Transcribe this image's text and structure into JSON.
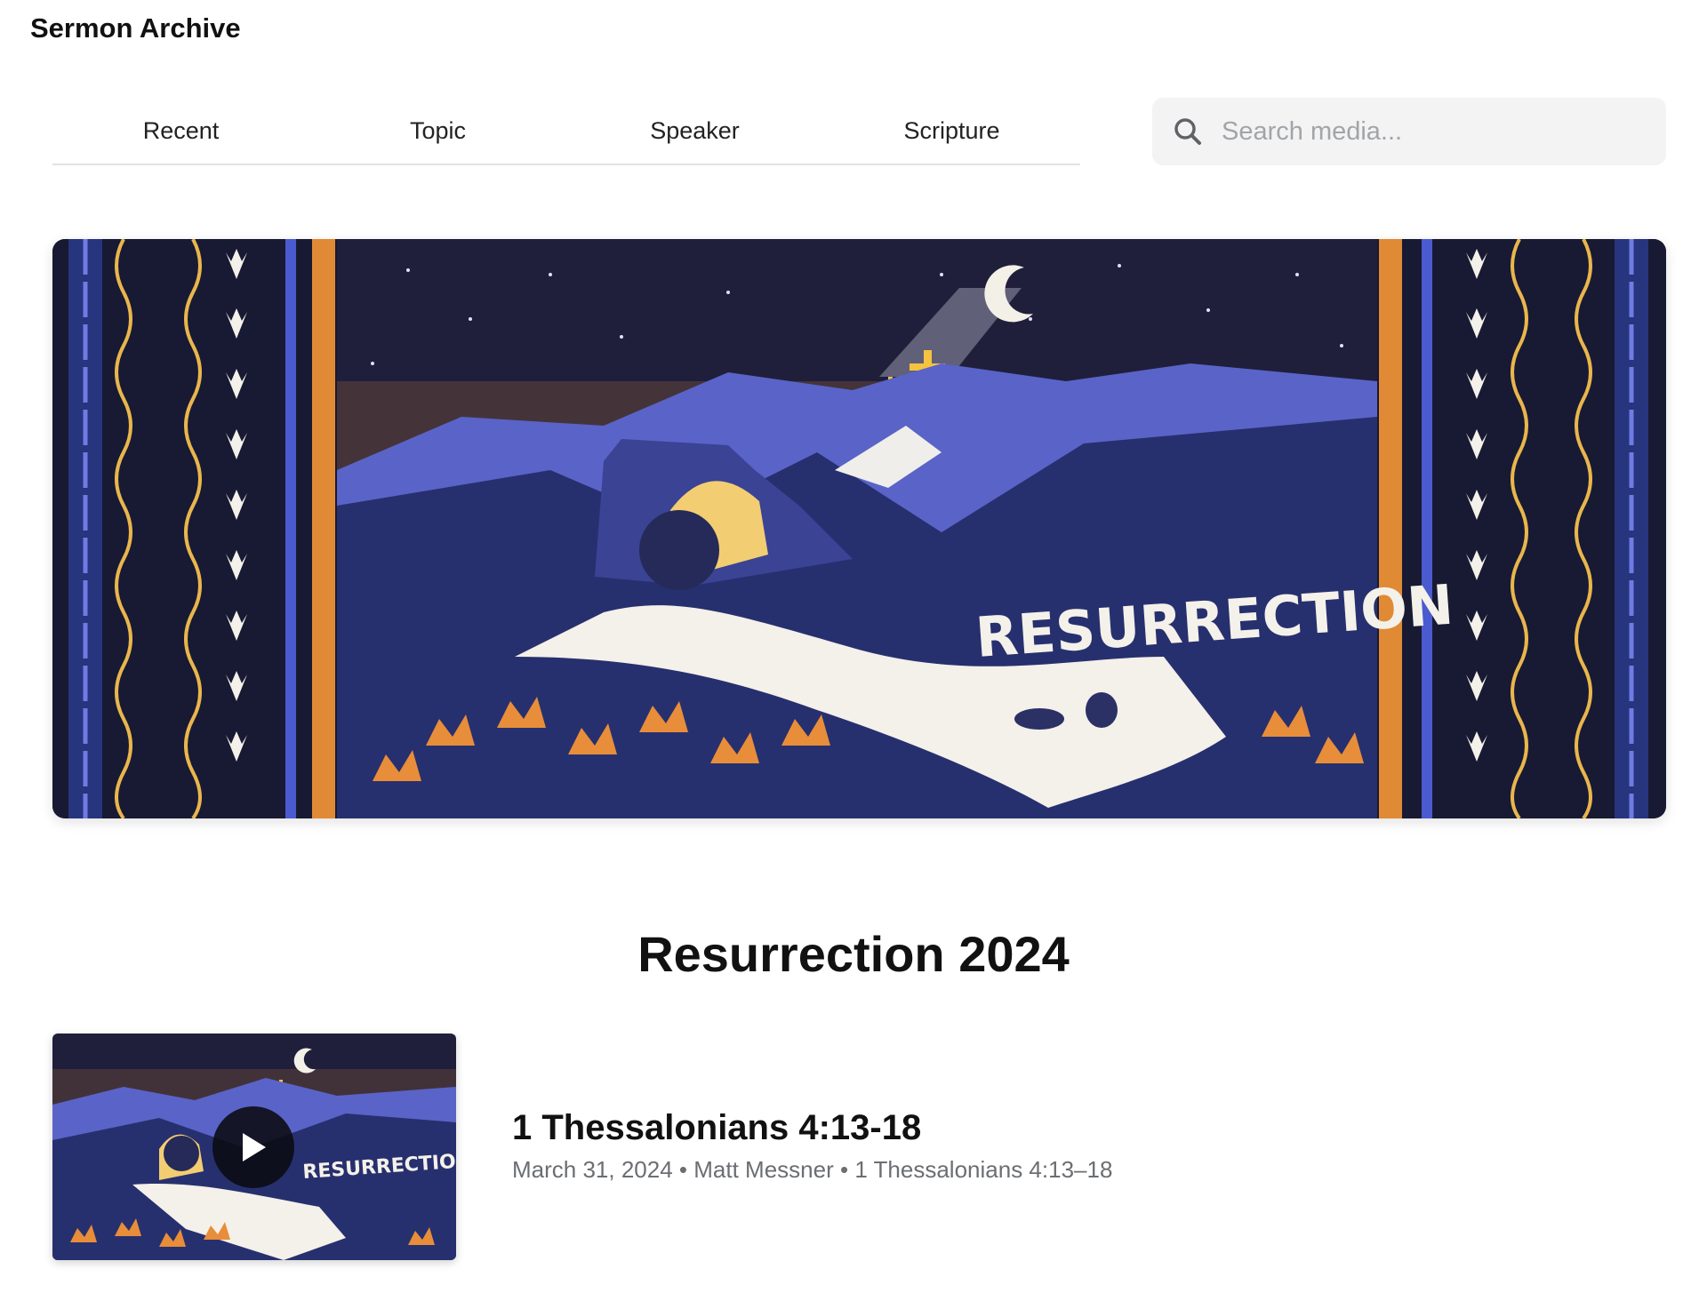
{
  "app": {
    "title": "Sermon Archive"
  },
  "nav": {
    "tabs": [
      {
        "label": "Recent"
      },
      {
        "label": "Topic"
      },
      {
        "label": "Speaker"
      },
      {
        "label": "Scripture"
      }
    ]
  },
  "search": {
    "placeholder": "Search media...",
    "value": "",
    "icon": "search-icon"
  },
  "hero": {
    "artwork_text": "RESURRECTION",
    "palette": {
      "night": "#1d1f3d",
      "mountain": "#5a63c8",
      "orange": "#e88d3a",
      "gold": "#f5c341",
      "path": "#f4f0ea"
    }
  },
  "series": {
    "title": "Resurrection 2024"
  },
  "media_items": [
    {
      "title": "1 Thessalonians 4:13-18",
      "date": "March 31, 2024",
      "speaker": "Matt Messner",
      "scripture": "1 Thessalonians 4:13–18",
      "thumbnail_text": "RESURRECTION",
      "play_icon": "play-icon"
    }
  ],
  "meta_separator": "•"
}
